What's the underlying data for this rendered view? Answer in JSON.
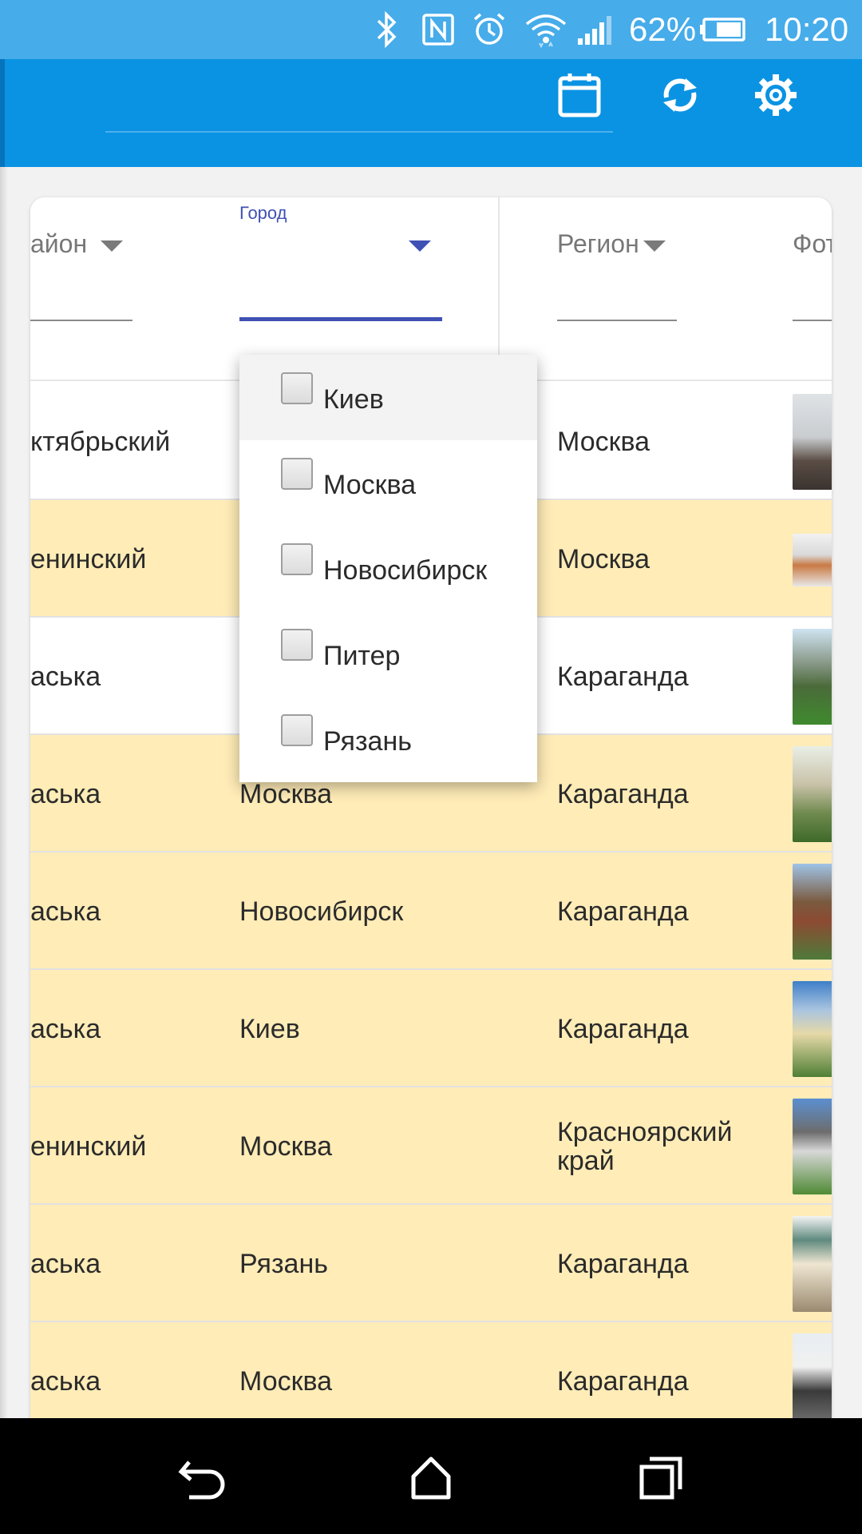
{
  "status_bar": {
    "battery_percent": "62%",
    "time": "10:20",
    "icons": [
      "bluetooth-icon",
      "nfc-icon",
      "alarm-icon",
      "wifi-icon",
      "signal-icon",
      "battery-icon"
    ]
  },
  "app_bar": {
    "actions": [
      "calendar-icon",
      "refresh-icon",
      "settings-icon"
    ],
    "color": "#0a93e3"
  },
  "table": {
    "headers": {
      "district": "айон",
      "city_floating_label": "Город",
      "region": "Регион",
      "photo": "Фот"
    },
    "rows": [
      {
        "district": "ктябрьский",
        "city": "",
        "region": "Москва",
        "bg": "#ffffff"
      },
      {
        "district": "енинский",
        "city": "",
        "region": "Москва",
        "bg": "#ffecb7"
      },
      {
        "district": "аська",
        "city": "",
        "region": "Караганда",
        "bg": "#ffffff"
      },
      {
        "district": "аська",
        "city": "Москва",
        "region": "Караганда",
        "bg": "#ffecb7"
      },
      {
        "district": "аська",
        "city": "Новосибирск",
        "region": "Караганда",
        "bg": "#ffecb7"
      },
      {
        "district": "аська",
        "city": "Киев",
        "region": "Караганда",
        "bg": "#ffecb7"
      },
      {
        "district": "енинский",
        "city": "Москва",
        "region": "Красноярский край",
        "bg": "#ffecb7"
      },
      {
        "district": "аська",
        "city": "Рязань",
        "region": "Караганда",
        "bg": "#ffecb7"
      },
      {
        "district": "аська",
        "city": "Москва",
        "region": "Караганда",
        "bg": "#ffecb7"
      }
    ]
  },
  "city_filter_menu": {
    "options": [
      {
        "label": "Киев",
        "checked": false
      },
      {
        "label": "Москва",
        "checked": false
      },
      {
        "label": "Новосибирск",
        "checked": false
      },
      {
        "label": "Питер",
        "checked": false
      },
      {
        "label": "Рязань",
        "checked": false
      }
    ],
    "accent": "#3f51b5"
  },
  "nav_bar": {
    "buttons": [
      "back-icon",
      "home-icon",
      "recents-icon"
    ]
  }
}
